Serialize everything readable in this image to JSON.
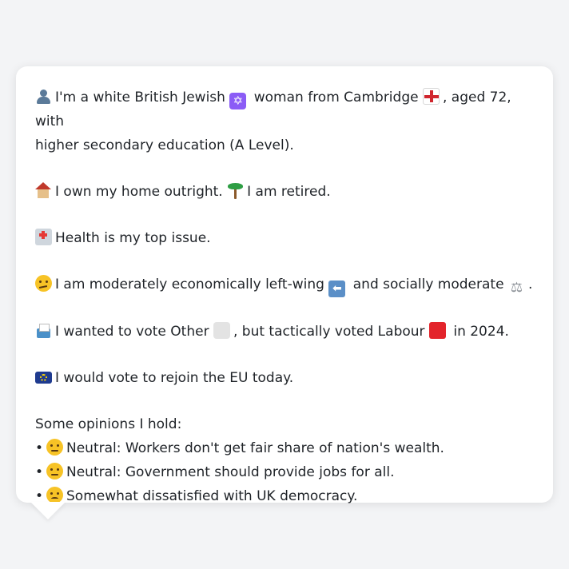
{
  "message": {
    "identity": {
      "part1": "I'm a white British Jewish",
      "part2": "woman from Cambridge",
      "part3": ", aged 72, with",
      "part4": "higher secondary education (A Level)."
    },
    "home": {
      "part1": "I own my home outright.",
      "part2": "I am retired."
    },
    "issue": "Health is my top issue.",
    "ideology": {
      "part1": "I am moderately economically left-wing",
      "part2": "and socially moderate",
      "part3": "."
    },
    "vote": {
      "part1": "I wanted to vote Other",
      "part2": ", but tactically voted Labour",
      "part3": "in 2024."
    },
    "eu": "I would vote to rejoin the EU today.",
    "opinions_heading": "Some opinions I hold:",
    "opinions": [
      {
        "bullet": "•",
        "text": "Neutral: Workers don't get fair share of nation's wealth."
      },
      {
        "bullet": "•",
        "text": "Neutral: Government should provide jobs for all."
      },
      {
        "bullet": "•",
        "text": "Somewhat dissatisfied with UK democracy."
      }
    ]
  },
  "icons": {
    "person": "person-icon",
    "star_of_david": "star-of-david-icon",
    "england_flag": "england-flag-icon",
    "house": "house-icon",
    "palm_tree": "palm-tree-icon",
    "hospital": "hospital-icon",
    "thinking_face": "thinking-face-icon",
    "left_arrow": "left-arrow-icon",
    "balance_scale": "balance-scale-icon",
    "ballot_box": "ballot-box-icon",
    "grey_square": "grey-square-icon",
    "red_square": "red-square-icon",
    "eu_flag": "eu-flag-icon",
    "neutral_face": "neutral-face-icon",
    "confused_face": "confused-face-icon"
  },
  "colors": {
    "background": "#f3f4f6",
    "card": "#ffffff",
    "text": "#1f2328",
    "labour_red": "#e3242b",
    "other_grey": "#e3e3e3"
  }
}
